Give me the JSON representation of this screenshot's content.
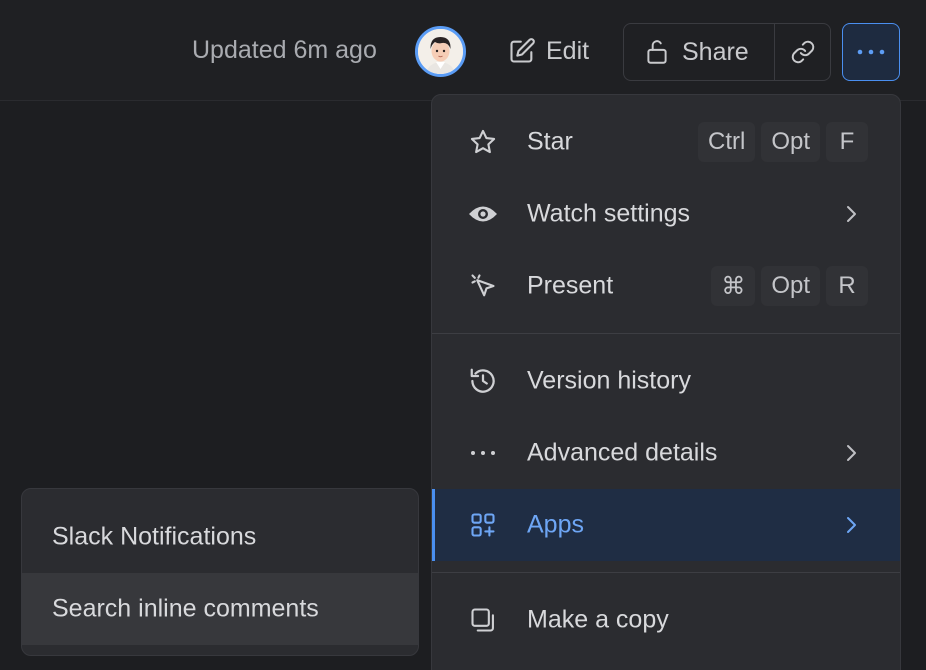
{
  "header": {
    "updated_text": "Updated 6m ago",
    "edit_label": "Edit",
    "share_label": "Share"
  },
  "colors": {
    "accent": "#4a8ff0",
    "background": "#1d1e21",
    "menu_bg": "#2b2c30",
    "active_bg": "#1f2d44"
  },
  "menu": {
    "star": {
      "label": "Star",
      "icon": "star-icon",
      "keys": [
        "Ctrl",
        "Opt",
        "F"
      ]
    },
    "watch": {
      "label": "Watch settings",
      "icon": "eye-icon"
    },
    "present": {
      "label": "Present",
      "icon": "pointer-icon",
      "keys": [
        "⌘",
        "Opt",
        "R"
      ]
    },
    "version": {
      "label": "Version history",
      "icon": "history-icon"
    },
    "advanced": {
      "label": "Advanced details",
      "icon": "more-horizontal-icon"
    },
    "apps": {
      "label": "Apps",
      "icon": "apps-icon"
    },
    "copy": {
      "label": "Make a copy",
      "icon": "copy-icon"
    }
  },
  "submenu": {
    "items": [
      {
        "label": "Slack Notifications"
      },
      {
        "label": "Search inline comments"
      }
    ]
  }
}
